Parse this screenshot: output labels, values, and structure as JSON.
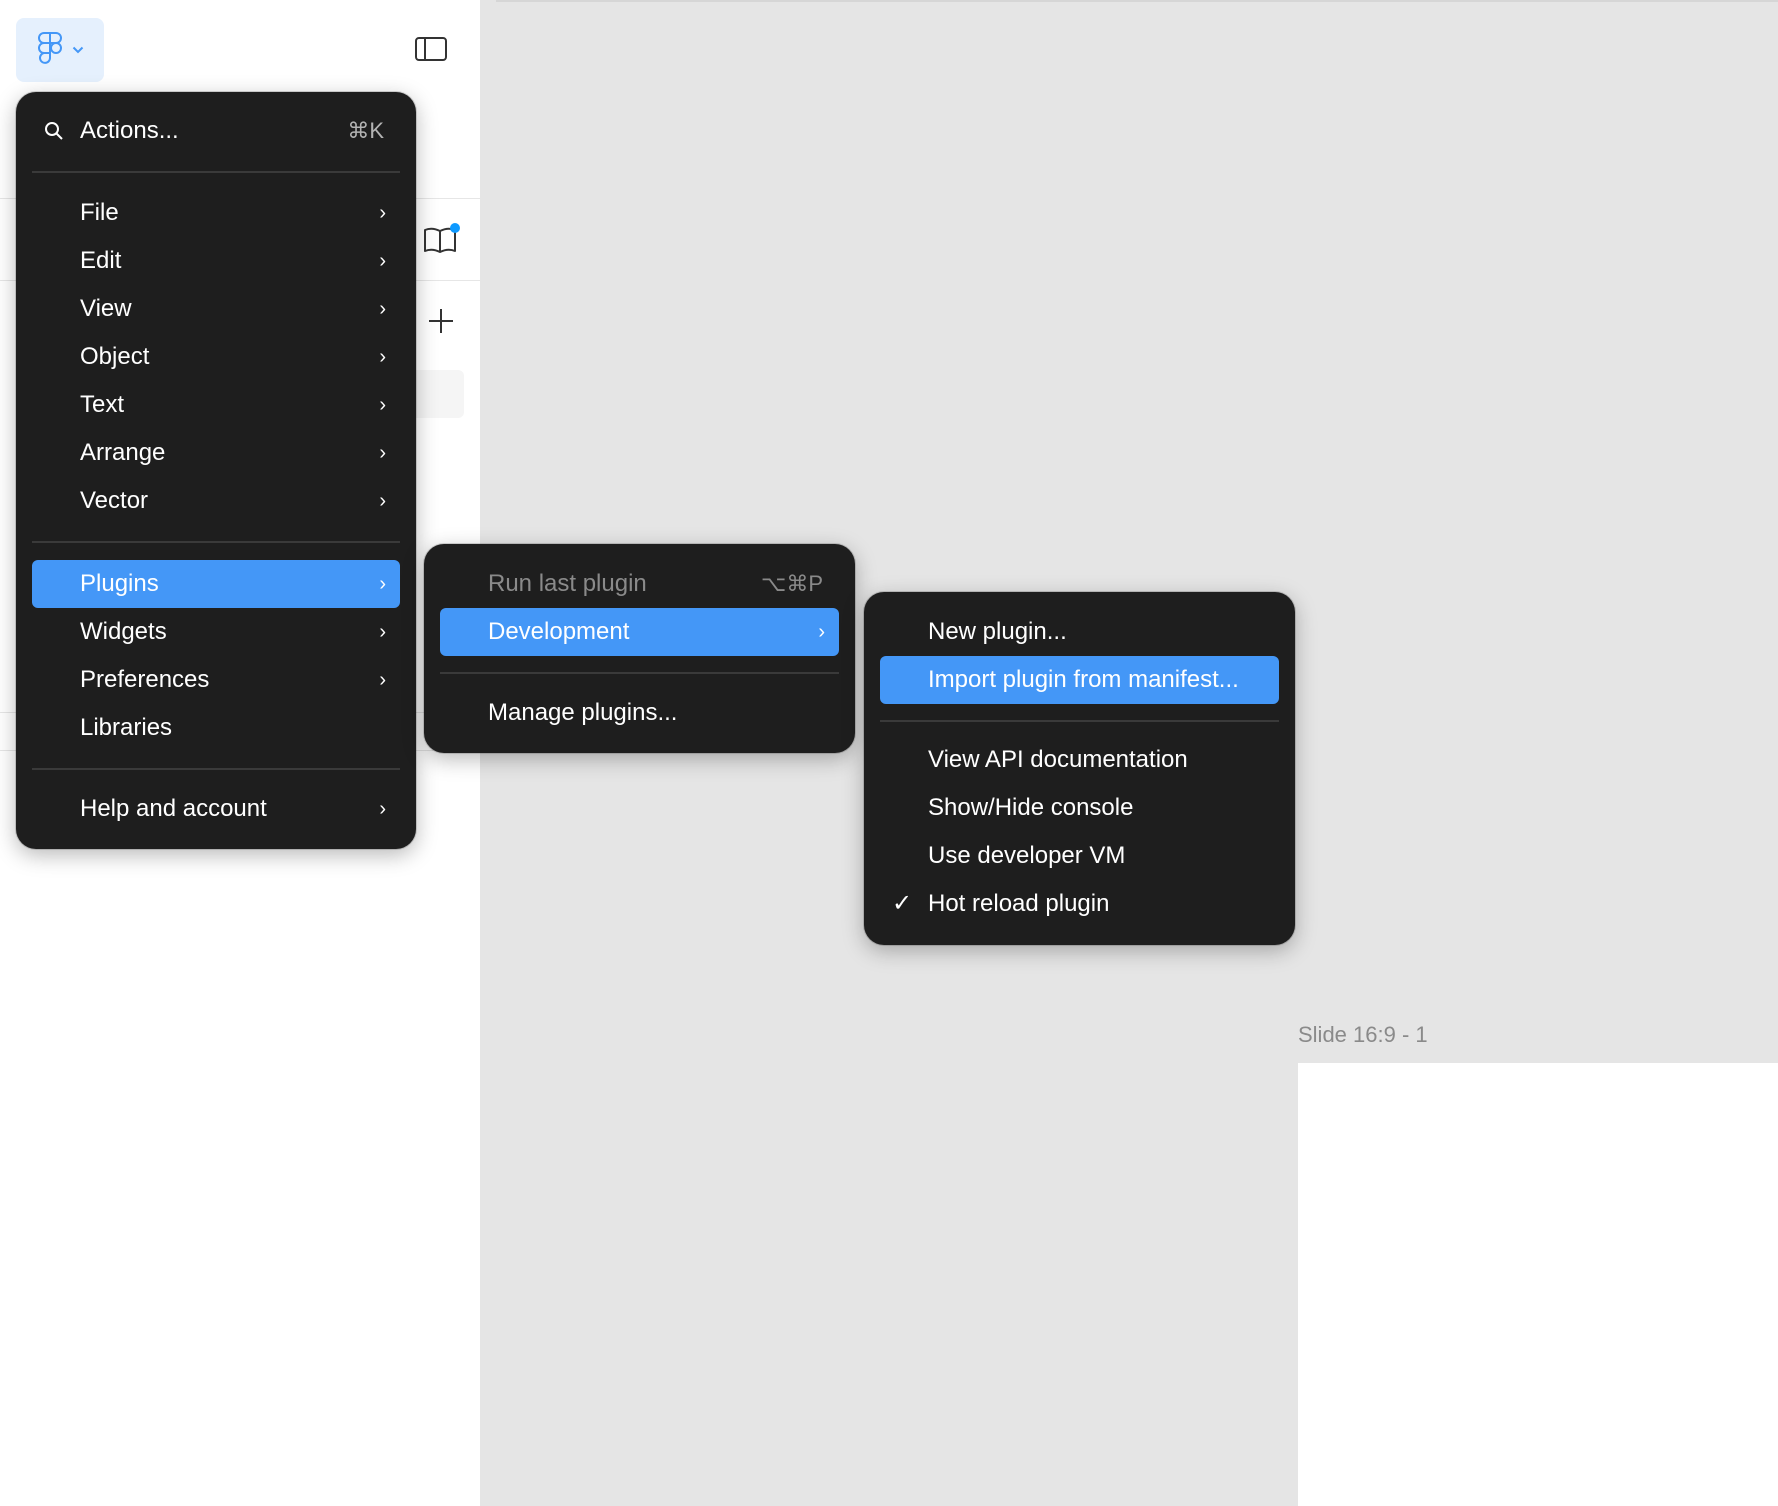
{
  "app": {
    "logo_icon": "figma-logo-icon",
    "logo_chevron_icon": "chevron-down-icon",
    "sidebar_toggle_icon": "sidebar-toggle-icon",
    "library_icon": "book-icon",
    "add_page_icon": "plus-icon",
    "accent_color": "#4497f7",
    "notification_dot_color": "#0d99ff",
    "menu_bg_color": "#1e1e1e"
  },
  "main_menu": {
    "search_icon": "search-icon",
    "actions_label": "Actions...",
    "actions_shortcut": "⌘K",
    "items": [
      {
        "label": "File",
        "chevron": "›"
      },
      {
        "label": "Edit",
        "chevron": "›"
      },
      {
        "label": "View",
        "chevron": "›"
      },
      {
        "label": "Object",
        "chevron": "›"
      },
      {
        "label": "Text",
        "chevron": "›"
      },
      {
        "label": "Arrange",
        "chevron": "›"
      },
      {
        "label": "Vector",
        "chevron": "›"
      },
      {
        "label": "Plugins",
        "chevron": "›"
      },
      {
        "label": "Widgets",
        "chevron": "›"
      },
      {
        "label": "Preferences",
        "chevron": "›"
      },
      {
        "label": "Libraries"
      },
      {
        "label": "Help and account",
        "chevron": "›"
      }
    ]
  },
  "plugins_menu": {
    "items": [
      {
        "label": "Run last plugin",
        "shortcut": "⌥⌘P",
        "disabled": true
      },
      {
        "label": "Development",
        "chevron": "›"
      },
      {
        "label": "Manage plugins..."
      }
    ]
  },
  "development_menu": {
    "items": [
      {
        "label": "New plugin..."
      },
      {
        "label": "Import plugin from manifest..."
      },
      {
        "label": "View API documentation"
      },
      {
        "label": "Show/Hide console"
      },
      {
        "label": "Use developer VM"
      },
      {
        "label": "Hot reload plugin",
        "checked": true,
        "check_mark": "✓"
      }
    ]
  },
  "canvas": {
    "slide_label": "Slide 16:9 - 1"
  }
}
